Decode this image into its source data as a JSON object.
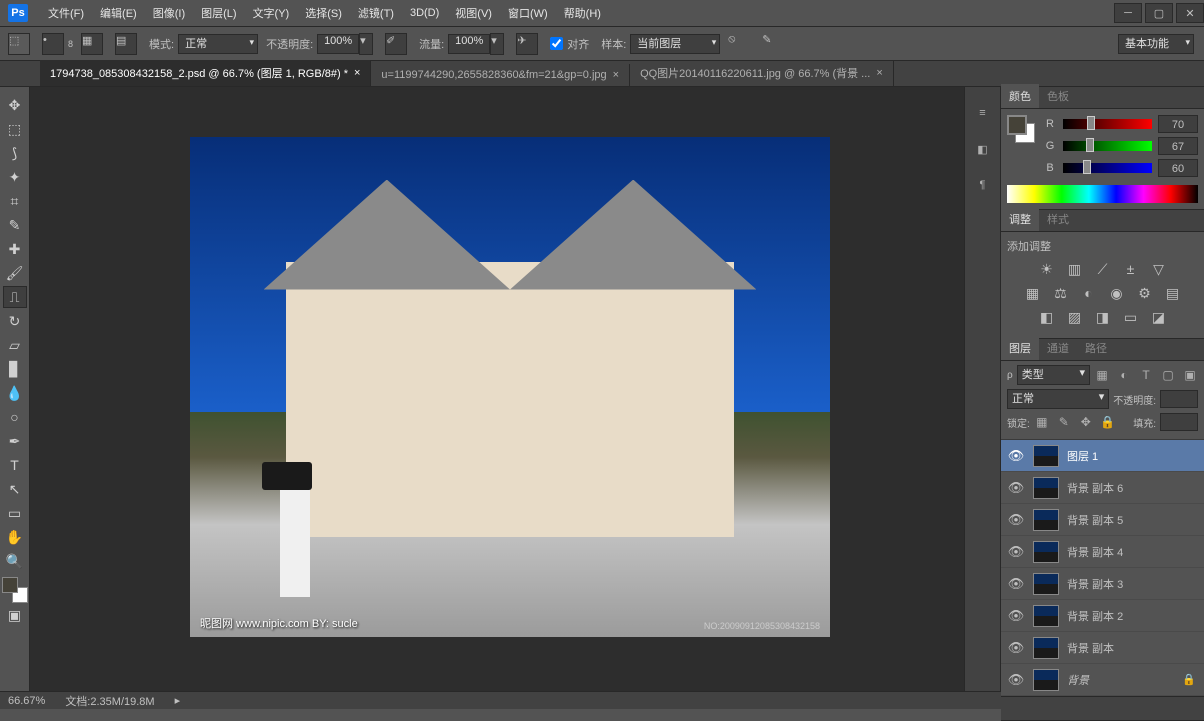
{
  "menu": {
    "items": [
      "文件(F)",
      "编辑(E)",
      "图像(I)",
      "图层(L)",
      "文字(Y)",
      "选择(S)",
      "滤镜(T)",
      "3D(D)",
      "视图(V)",
      "窗口(W)",
      "帮助(H)"
    ]
  },
  "options": {
    "brush_size": "8",
    "mode_label": "模式:",
    "mode_value": "正常",
    "opacity_label": "不透明度:",
    "opacity_value": "100%",
    "flow_label": "流量:",
    "flow_value": "100%",
    "align_label": "对齐",
    "sample_label": "样本:",
    "sample_value": "当前图层",
    "workspace": "基本功能"
  },
  "tabs": [
    {
      "label": "1794738_085308432158_2.psd @ 66.7% (图层 1, RGB/8#) *",
      "active": true
    },
    {
      "label": "u=1199744290,2655828360&fm=21&gp=0.jpg",
      "active": false
    },
    {
      "label": "QQ图片20140116220611.jpg @ 66.7% (背景 ...",
      "active": false
    }
  ],
  "canvas": {
    "watermark_left": "昵图网  www.nipic.com    BY: sucle",
    "watermark_right": "NO:20090912085308432158"
  },
  "color_panel": {
    "tabs": [
      "颜色",
      "色板"
    ],
    "r_label": "R",
    "r_value": "70",
    "g_label": "G",
    "g_value": "67",
    "b_label": "B",
    "b_value": "60"
  },
  "adjustments_panel": {
    "tabs": [
      "调整",
      "样式"
    ],
    "title": "添加调整"
  },
  "layers_panel": {
    "tabs": [
      "图层",
      "通道",
      "路径"
    ],
    "kind_label": "类型",
    "blend_mode": "正常",
    "opacity_label": "不透明度:",
    "lock_label": "锁定:",
    "fill_label": "填充:",
    "layers": [
      {
        "name": "图层 1",
        "selected": true,
        "locked": false
      },
      {
        "name": "背景 副本 6",
        "selected": false,
        "locked": false
      },
      {
        "name": "背景 副本 5",
        "selected": false,
        "locked": false
      },
      {
        "name": "背景 副本 4",
        "selected": false,
        "locked": false
      },
      {
        "name": "背景 副本 3",
        "selected": false,
        "locked": false
      },
      {
        "name": "背景 副本 2",
        "selected": false,
        "locked": false
      },
      {
        "name": "背景 副本",
        "selected": false,
        "locked": false
      },
      {
        "name": "背景",
        "selected": false,
        "locked": true,
        "italic": true
      }
    ]
  },
  "statusbar": {
    "zoom": "66.67%",
    "doc_label": "文档:",
    "doc_value": "2.35M/19.8M"
  }
}
